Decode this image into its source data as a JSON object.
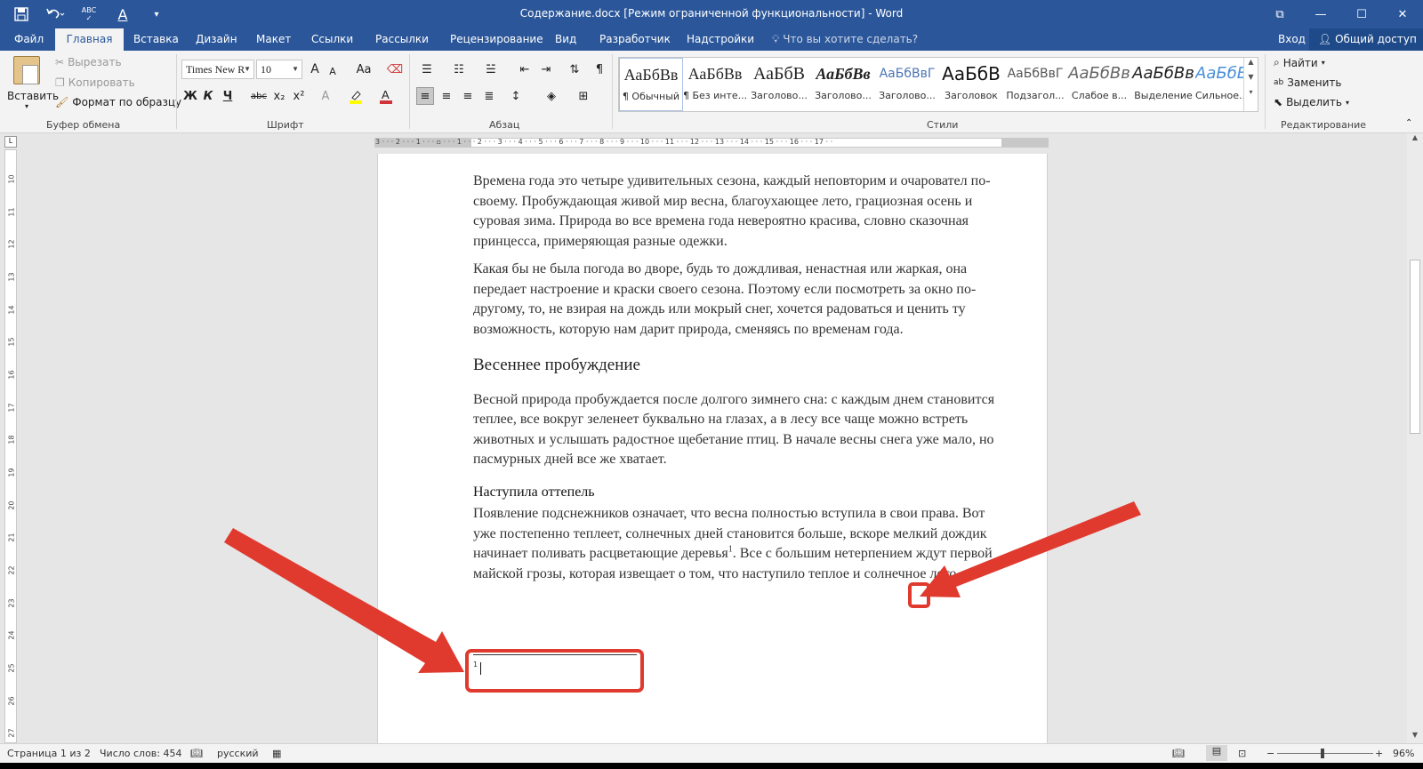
{
  "window": {
    "title": "Содержание.docx [Режим ограниченной функциональности] - Word",
    "controls": [
      "⧉",
      "—",
      "☐",
      "✕"
    ]
  },
  "qat": {
    "icons": [
      "save-icon",
      "undo-icon",
      "spelling-icon",
      "font-color-icon",
      "customize-icon"
    ],
    "spell_label": "ABC"
  },
  "tabs": {
    "file": "Файл",
    "home": "Главная",
    "insert": "Вставка",
    "design": "Дизайн",
    "layout": "Макет",
    "references": "Ссылки",
    "mailings": "Рассылки",
    "review": "Рецензирование",
    "view": "Вид",
    "developer": "Разработчик",
    "addins": "Надстройки",
    "tell_me": "Что вы хотите сделать?",
    "login": "Вход",
    "share": "Общий доступ"
  },
  "clipboard": {
    "paste": "Вставить",
    "cut": "Вырезать",
    "copy": "Копировать",
    "format_painter": "Формат по образцу",
    "label": "Буфер обмена"
  },
  "font": {
    "name": "Times New R",
    "size": "10",
    "label": "Шрифт",
    "bold": "Ж",
    "italic": "К",
    "underline": "Ч",
    "strike": "abc",
    "sub": "x₂",
    "sup": "x²",
    "grow": "A",
    "shrink": "A",
    "case": "Aa",
    "color_accent": "#d13438",
    "highlight_accent": "#ffff00"
  },
  "paragraph": {
    "label": "Абзац"
  },
  "styles": {
    "label": "Стили",
    "items": [
      {
        "sample": "АаБбВв",
        "name": "¶ Обычный"
      },
      {
        "sample": "АаБбВв",
        "name": "¶ Без инте..."
      },
      {
        "sample": "АаБбВ",
        "name": "Заголово..."
      },
      {
        "sample": "АаБбВв",
        "name": "Заголово..."
      },
      {
        "sample": "АаБбВвГ",
        "name": "Заголово..."
      },
      {
        "sample": "АаБбВ",
        "name": "Заголовок"
      },
      {
        "sample": "АаБбВвГ",
        "name": "Подзагол..."
      },
      {
        "sample": "АаБбВв",
        "name": "Слабое в..."
      },
      {
        "sample": "АаБбВв",
        "name": "Выделение"
      },
      {
        "sample": "АаБбВв",
        "name": "Сильное..."
      }
    ]
  },
  "editing": {
    "find": "Найти",
    "replace": "Заменить",
    "select": "Выделить",
    "label": "Редактирование"
  },
  "ruler": {
    "h_numbers": "3 · · · 2 · · · 1 · · · ▫ · · · 1 · · · 2 · · · 3 · · · 4 · · · 5 · · · 6 · · · 7 · · · 8 · · · 9 · · · 10 · · · 11 · · · 12 · · · 13 · · · 14 · · · 15 · · · 16 · · · 17 · ·",
    "v_numbers": [
      "10",
      "11",
      "12",
      "13",
      "14",
      "15",
      "16",
      "17",
      "18",
      "19",
      "20",
      "21",
      "22",
      "23",
      "24",
      "25",
      "26",
      "27"
    ],
    "corner": "L"
  },
  "document": {
    "p1": "Времена года это четыре удивительных сезона, каждый неповторим и очаровател по-своему. Пробуждающая живой мир весна, благоухающее лето, грациозная осень и суровая зима. Природа во все времена года невероятно красива, словно сказочная принцесса, примеряющая разные одежки.",
    "p2": "Какая бы не была погода во дворе, будь то дождливая, ненастная или жаркая, она передает настроение и краски своего сезона. Поэтому если посмотреть за окно по-другому, то, не взирая на дождь или мокрый снег, хочется радоваться и ценить ту возможность, которую нам дарит природа, сменяясь по временам года.",
    "h2": "Весеннее пробуждение",
    "p3": "Весной природа пробуждается после долгого зимнего сна: с каждым днем становится теплее, все вокруг зеленеет буквально на глазах, а в лесу все чаще можно встреть животных и услышать радостное щебетание птиц. В начале весны снега уже мало, но пасмурных дней все же хватает.",
    "h3": "Наступила оттепель",
    "p4_a": "Появление подснежников означает, что весна полностью вступила в свои права. Вот уже постепенно теплеет, солнечных дней становится больше, вскоре мелкий дождик начинает поливать расцветающие деревья",
    "p4_ref": "1",
    "p4_b": ". Все с большим нетерпением ждут первой майской грозы, которая извещает о том, что наступило теплое и солнечное лето.",
    "footnote_num": "1"
  },
  "statusbar": {
    "page": "Страница 1 из 2",
    "words": "Число слов: 454",
    "lang": "русский",
    "zoom": "96%",
    "zoom_minus": "−",
    "zoom_plus": "+"
  },
  "annotation_color": "#e03a2f"
}
